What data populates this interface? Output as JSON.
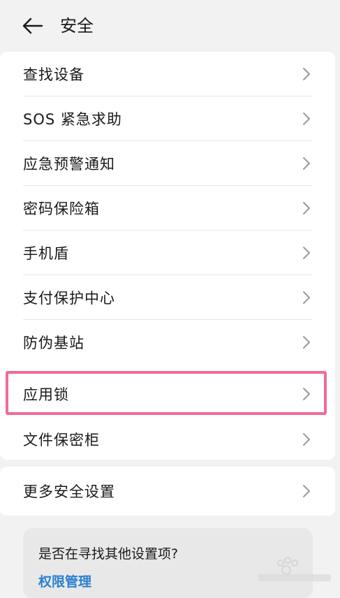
{
  "header": {
    "title": "安全",
    "back_icon": "arrow-left-icon"
  },
  "menu": {
    "items": [
      {
        "label": "查找设备"
      },
      {
        "label": "SOS 紧急求助"
      },
      {
        "label": "应急预警通知"
      },
      {
        "label": "密码保险箱"
      },
      {
        "label": "手机盾"
      },
      {
        "label": "支付保护中心"
      },
      {
        "label": "防伪基站"
      },
      {
        "label": "应用锁",
        "highlighted": true
      },
      {
        "label": "文件保密柜"
      }
    ]
  },
  "more": {
    "label": "更多安全设置"
  },
  "suggestion": {
    "question": "是否在寻找其他设置项?",
    "link": "权限管理"
  },
  "colors": {
    "background": "#f2f2f2",
    "card": "#ffffff",
    "highlight_border": "#f06b97",
    "link": "#2a7fd0"
  }
}
